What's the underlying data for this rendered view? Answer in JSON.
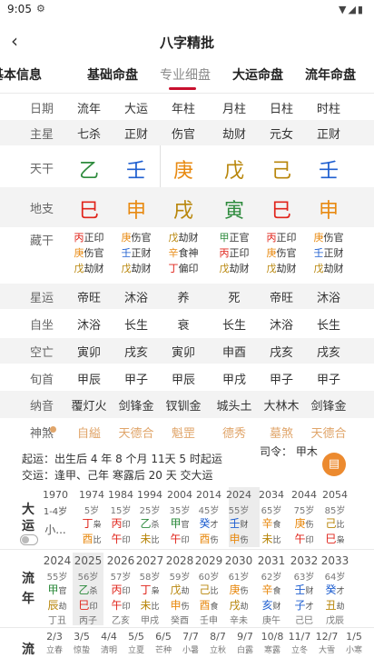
{
  "status_bar": {
    "time": "9:05"
  },
  "header": {
    "title": "八字精批"
  },
  "tabs": [
    "基本信息",
    "基础命盘",
    "专业细盘",
    "大运命盘",
    "流年命盘"
  ],
  "colors": {
    "wood": "#2e8b3d",
    "fire": "#e0241b",
    "earth": "#b8860b",
    "metal": "#e88a12",
    "water": "#1f5fd0",
    "tab_active": "#8c8c8c",
    "accent": "#c8102e"
  },
  "grid": {
    "header": [
      "日期",
      "流年",
      "大运",
      "年柱",
      "月柱",
      "日柱",
      "时柱"
    ],
    "zhuxing": {
      "label": "主星",
      "values": [
        "七杀",
        "正财",
        "伤官",
        "劫财",
        "元女",
        "正财"
      ]
    },
    "tiangan": {
      "label": "天干",
      "chars": [
        "乙",
        "壬",
        "庚",
        "戊",
        "己",
        "壬"
      ],
      "colors": [
        "#2e8b3d",
        "#1f5fd0",
        "#e88a12",
        "#b8860b",
        "#b8860b",
        "#1f5fd0"
      ]
    },
    "dizhi": {
      "label": "地支",
      "chars": [
        "巳",
        "申",
        "戌",
        "寅",
        "巳",
        "申"
      ],
      "colors": [
        "#e0241b",
        "#e88a12",
        "#b8860b",
        "#2e8b3d",
        "#e0241b",
        "#e88a12"
      ]
    },
    "canggan": {
      "label": "藏干",
      "cols": [
        [
          [
            "丙",
            "正印",
            "#e0241b"
          ],
          [
            "庚",
            "伤官",
            "#e88a12"
          ],
          [
            "戊",
            "劫财",
            "#b8860b"
          ]
        ],
        [
          [
            "庚",
            "伤官",
            "#e88a12"
          ],
          [
            "壬",
            "正财",
            "#1f5fd0"
          ],
          [
            "戊",
            "劫财",
            "#b8860b"
          ]
        ],
        [
          [
            "戊",
            "劫财",
            "#b8860b"
          ],
          [
            "辛",
            "食神",
            "#e88a12"
          ],
          [
            "丁",
            "偏印",
            "#e0241b"
          ]
        ],
        [
          [
            "甲",
            "正官",
            "#2e8b3d"
          ],
          [
            "丙",
            "正印",
            "#e0241b"
          ],
          [
            "戊",
            "劫财",
            "#b8860b"
          ]
        ],
        [
          [
            "丙",
            "正印",
            "#e0241b"
          ],
          [
            "庚",
            "伤官",
            "#e88a12"
          ],
          [
            "戊",
            "劫财",
            "#b8860b"
          ]
        ],
        [
          [
            "庚",
            "伤官",
            "#e88a12"
          ],
          [
            "壬",
            "正财",
            "#1f5fd0"
          ],
          [
            "戊",
            "劫财",
            "#b8860b"
          ]
        ]
      ]
    },
    "xingyun": {
      "label": "星运",
      "values": [
        "帝旺",
        "沐浴",
        "养",
        "死",
        "帝旺",
        "沐浴"
      ]
    },
    "zizuo": {
      "label": "自坐",
      "values": [
        "沐浴",
        "长生",
        "衰",
        "长生",
        "沐浴",
        "长生"
      ]
    },
    "kongwang": {
      "label": "空亡",
      "values": [
        "寅卯",
        "戌亥",
        "寅卯",
        "申酉",
        "戌亥",
        "戌亥"
      ]
    },
    "xunshou": {
      "label": "旬首",
      "values": [
        "甲辰",
        "甲子",
        "甲辰",
        "甲戌",
        "甲子",
        "甲子"
      ]
    },
    "nayin": {
      "label": "纳音",
      "values": [
        "覆灯火",
        "剑锋金",
        "钗钏金",
        "城头土",
        "大林木",
        "剑锋金"
      ]
    },
    "shensha": {
      "label": "神煞",
      "values": [
        "自縊",
        "天德合",
        "魁罡",
        "德秀",
        "墓煞",
        "天德合"
      ]
    }
  },
  "qiyun": {
    "line1": "起运：出生后 4 年 8 个月 11天 5 时起运",
    "line2": "交运：逢甲、己年 寒露后 20 天 交大运",
    "siling": "司令： 甲木"
  },
  "dayun": {
    "label": "大运",
    "first": {
      "year": "1970",
      "age": "1-4岁",
      "name": "小..."
    },
    "items": [
      {
        "year": "1974",
        "age": "5岁",
        "g": "丁",
        "gs": "枭",
        "gc": "#e0241b",
        "z": "酉",
        "zs": "比",
        "zc": "#e88a12"
      },
      {
        "year": "1984",
        "age": "15岁",
        "g": "丙",
        "gs": "印",
        "gc": "#e0241b",
        "z": "午",
        "zs": "印",
        "zc": "#e0241b"
      },
      {
        "year": "1994",
        "age": "25岁",
        "g": "乙",
        "gs": "杀",
        "gc": "#2e8b3d",
        "z": "未",
        "zs": "比",
        "zc": "#b8860b"
      },
      {
        "year": "2004",
        "age": "35岁",
        "g": "甲",
        "gs": "官",
        "gc": "#2e8b3d",
        "z": "午",
        "zs": "印",
        "zc": "#e0241b"
      },
      {
        "year": "2014",
        "age": "45岁",
        "g": "癸",
        "gs": "才",
        "gc": "#1f5fd0",
        "z": "酉",
        "zs": "伤",
        "zc": "#e88a12"
      },
      {
        "year": "2024",
        "age": "55岁",
        "g": "壬",
        "gs": "财",
        "gc": "#1f5fd0",
        "z": "申",
        "zs": "伤",
        "zc": "#e88a12"
      },
      {
        "year": "2034",
        "age": "65岁",
        "g": "辛",
        "gs": "食",
        "gc": "#e88a12",
        "z": "未",
        "zs": "比",
        "zc": "#b8860b"
      },
      {
        "year": "2044",
        "age": "75岁",
        "g": "庚",
        "gs": "伤",
        "gc": "#e88a12",
        "z": "午",
        "zs": "印",
        "zc": "#e0241b"
      },
      {
        "year": "2054",
        "age": "85岁",
        "g": "己",
        "gs": "比",
        "gc": "#b8860b",
        "z": "巳",
        "zs": "枭",
        "zc": "#e0241b"
      }
    ]
  },
  "liunian": {
    "label": "流年",
    "items": [
      {
        "year": "2024",
        "age": "55岁",
        "g": "甲",
        "gs": "官",
        "gc": "#2e8b3d",
        "z": "辰",
        "zs": "劫",
        "zc": "#b8860b",
        "b": "丁丑"
      },
      {
        "year": "2025",
        "age": "56岁",
        "g": "乙",
        "gs": "杀",
        "gc": "#2e8b3d",
        "z": "巳",
        "zs": "印",
        "zc": "#e0241b",
        "b": "丙子"
      },
      {
        "year": "2026",
        "age": "57岁",
        "g": "丙",
        "gs": "印",
        "gc": "#e0241b",
        "z": "午",
        "zs": "印",
        "zc": "#e0241b",
        "b": "乙亥"
      },
      {
        "year": "2027",
        "age": "58岁",
        "g": "丁",
        "gs": "枭",
        "gc": "#e0241b",
        "z": "未",
        "zs": "比",
        "zc": "#b8860b",
        "b": "甲戌"
      },
      {
        "year": "2028",
        "age": "59岁",
        "g": "戊",
        "gs": "劫",
        "gc": "#b8860b",
        "z": "申",
        "zs": "伤",
        "zc": "#e88a12",
        "b": "癸酉"
      },
      {
        "year": "2029",
        "age": "60岁",
        "g": "己",
        "gs": "比",
        "gc": "#b8860b",
        "z": "酉",
        "zs": "食",
        "zc": "#e88a12",
        "b": "壬申"
      },
      {
        "year": "2030",
        "age": "61岁",
        "g": "庚",
        "gs": "伤",
        "gc": "#e88a12",
        "z": "戌",
        "zs": "劫",
        "zc": "#b8860b",
        "b": "辛未"
      },
      {
        "year": "2031",
        "age": "62岁",
        "g": "辛",
        "gs": "食",
        "gc": "#e88a12",
        "z": "亥",
        "zs": "财",
        "zc": "#1f5fd0",
        "b": "庚午"
      },
      {
        "year": "2032",
        "age": "63岁",
        "g": "壬",
        "gs": "财",
        "gc": "#1f5fd0",
        "z": "子",
        "zs": "才",
        "zc": "#1f5fd0",
        "b": "己巳"
      },
      {
        "year": "2033",
        "age": "64岁",
        "g": "癸",
        "gs": "才",
        "gc": "#1f5fd0",
        "z": "丑",
        "zs": "劫",
        "zc": "#b8860b",
        "b": "戊辰"
      }
    ]
  },
  "liuyue": {
    "label": "流",
    "dates": [
      "2/3",
      "3/5",
      "4/4",
      "5/5",
      "6/5",
      "7/7",
      "8/7",
      "9/7",
      "10/8",
      "11/7",
      "12/7",
      "1/5"
    ],
    "terms": [
      "立春",
      "惊蛰",
      "清明",
      "立夏",
      "芒种",
      "小暑",
      "立秋",
      "白露",
      "寒露",
      "立冬",
      "大雪",
      "小寒"
    ]
  }
}
